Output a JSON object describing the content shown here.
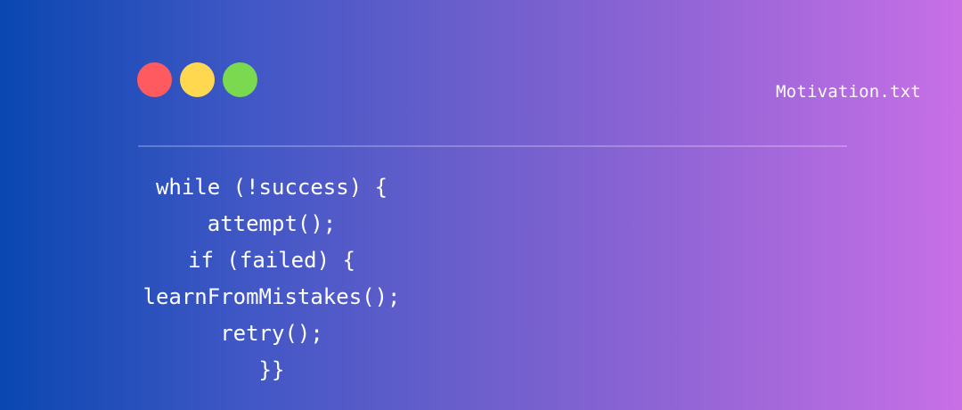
{
  "window": {
    "title": "Motivation.txt",
    "controls": [
      {
        "name": "close",
        "color": "#ff5a5f"
      },
      {
        "name": "minimize",
        "color": "#ffd84f"
      },
      {
        "name": "maximize",
        "color": "#7ad94f"
      }
    ]
  },
  "code": {
    "lines": [
      "while (!success) {",
      "attempt();",
      "if (failed) {",
      "learnFromMistakes();",
      "retry();",
      "}}"
    ]
  },
  "colors": {
    "gradient_start": "#0a47b0",
    "gradient_end": "#c86fe6",
    "text": "#ffffff"
  }
}
